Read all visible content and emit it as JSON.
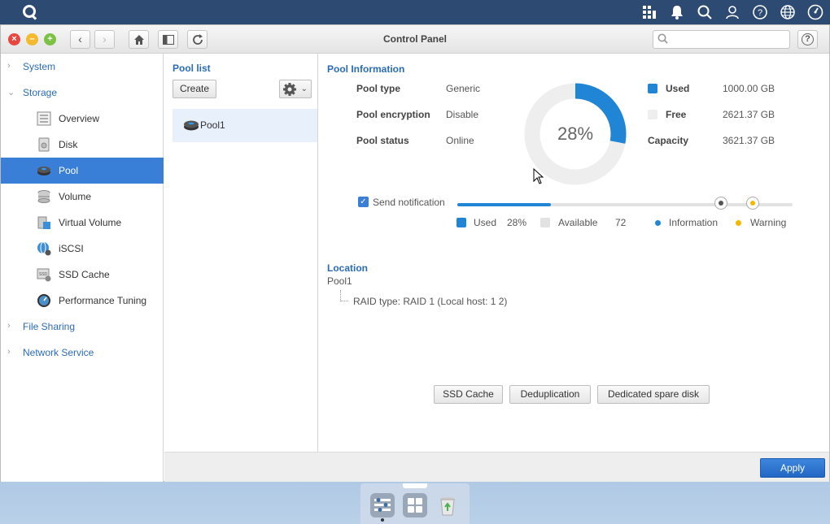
{
  "window": {
    "title": "Control Panel",
    "search_placeholder": ""
  },
  "sidebar": {
    "groups": [
      {
        "label": "System"
      },
      {
        "label": "Storage"
      },
      {
        "label": "File Sharing"
      },
      {
        "label": "Network Service"
      }
    ],
    "storage_items": [
      {
        "label": "Overview"
      },
      {
        "label": "Disk"
      },
      {
        "label": "Pool"
      },
      {
        "label": "Volume"
      },
      {
        "label": "Virtual Volume"
      },
      {
        "label": "iSCSI"
      },
      {
        "label": "SSD Cache"
      },
      {
        "label": "Performance Tuning"
      }
    ],
    "active_item": "Pool"
  },
  "pool_list": {
    "title": "Pool list",
    "create_label": "Create",
    "pools": [
      {
        "name": "Pool1"
      }
    ]
  },
  "pool_info": {
    "title": "Pool Information",
    "fields": [
      {
        "key": "Pool type",
        "value": "Generic"
      },
      {
        "key": "Pool encryption",
        "value": "Disable"
      },
      {
        "key": "Pool status",
        "value": "Online"
      }
    ],
    "usage_percent_label": "28%",
    "usage_fraction": 0.28,
    "legend": [
      {
        "key": "Used",
        "value": "1000.00 GB"
      },
      {
        "key": "Free",
        "value": "2621.37 GB"
      },
      {
        "key": "Capacity",
        "value": "3621.37 GB"
      }
    ],
    "colors": {
      "used": "#2185d5",
      "free": "#eeeeee",
      "info": "#2185d5",
      "warning": "#f5b800"
    }
  },
  "notification": {
    "label": "Send notification",
    "checked": true,
    "used_fraction": 0.28,
    "legend": {
      "used_label": "Used",
      "used_value": "28%",
      "available_label": "Available",
      "available_value": "72",
      "information_label": "Information",
      "warning_label": "Warning"
    }
  },
  "location": {
    "title": "Location",
    "pool_name": "Pool1",
    "raid_text": "RAID type: RAID 1 (Local host: 1 2)"
  },
  "actions": {
    "ssd_cache": "SSD Cache",
    "deduplication": "Deduplication",
    "spare_disk": "Dedicated spare disk",
    "apply": "Apply"
  },
  "topbar_icons": [
    "apps-icon",
    "bell-icon",
    "search-icon",
    "user-icon",
    "help-icon",
    "globe-icon",
    "gauge-icon"
  ]
}
